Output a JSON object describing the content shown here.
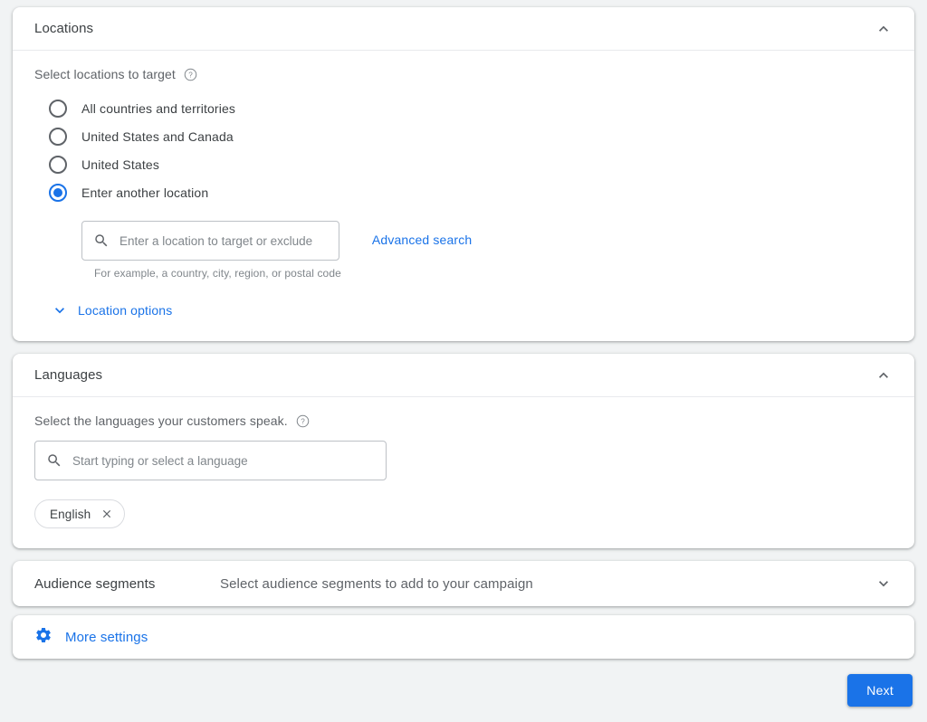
{
  "locations": {
    "title": "Locations",
    "collapse_icon": "chevron-up-icon",
    "prompt": "Select locations to target",
    "help_icon": "help-icon",
    "options": [
      {
        "label": "All countries and territories",
        "selected": false
      },
      {
        "label": "United States and Canada",
        "selected": false
      },
      {
        "label": "United States",
        "selected": false
      },
      {
        "label": "Enter another location",
        "selected": true
      }
    ],
    "search": {
      "icon": "search-icon",
      "placeholder": "Enter a location to target or exclude",
      "value": "",
      "hint": "For example, a country, city, region, or postal code"
    },
    "advanced_search_label": "Advanced search",
    "location_options_label": "Location options",
    "location_options_icon": "chevron-down-icon"
  },
  "languages": {
    "title": "Languages",
    "collapse_icon": "chevron-up-icon",
    "prompt": "Select the languages your customers speak.",
    "help_icon": "help-icon",
    "search": {
      "icon": "search-icon",
      "placeholder": "Start typing or select a language",
      "value": ""
    },
    "chips": [
      {
        "label": "English",
        "remove_icon": "close-icon"
      }
    ]
  },
  "audience_segments": {
    "title": "Audience segments",
    "subtitle": "Select audience segments to add to your campaign",
    "expand_icon": "chevron-down-icon"
  },
  "more_settings": {
    "label": "More settings",
    "icon": "gear-icon"
  },
  "footer": {
    "next_label": "Next"
  },
  "colors": {
    "accent": "#1a73e8",
    "page_background": "#f1f3f4",
    "card_background": "#ffffff",
    "primary_text": "#3c4043",
    "secondary_text": "#5f6368",
    "border": "#dadce0"
  }
}
